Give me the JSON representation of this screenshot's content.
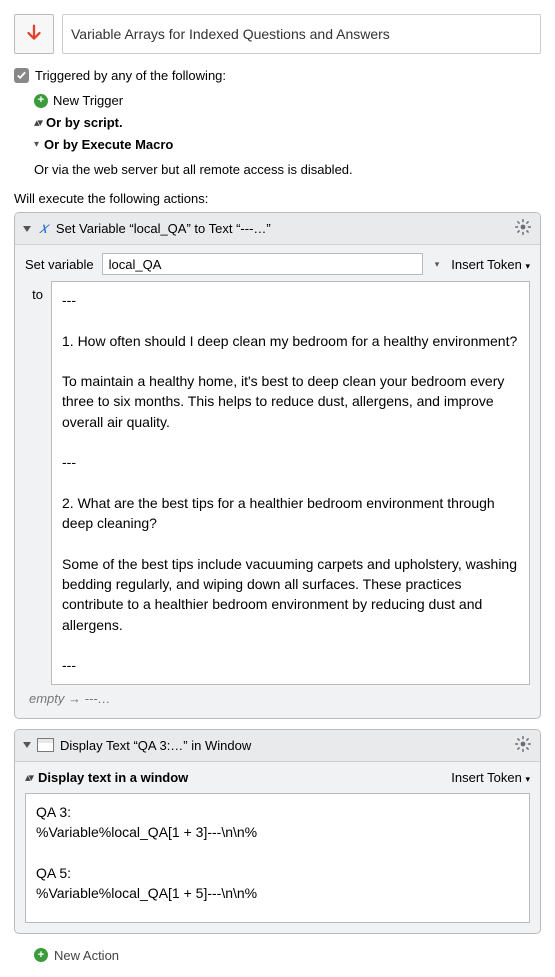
{
  "title": "Variable Arrays for Indexed Questions and Answers",
  "triggered_label": "Triggered by any of the following:",
  "triggers": {
    "new_trigger": "New Trigger",
    "or_script": "Or by script.",
    "or_execute_macro": "Or by Execute Macro",
    "web_note": "Or via the web server but all remote access is disabled."
  },
  "exec_label": "Will execute the following actions:",
  "action1": {
    "header": "Set Variable “local_QA” to Text “---…”",
    "set_variable_label": "Set variable",
    "variable_name": "local_QA",
    "insert_token": "Insert Token",
    "to_label": "to",
    "text_value": "---\n\n1. How often should I deep clean my bedroom for a healthy environment?\n\nTo maintain a healthy home, it's best to deep clean your bedroom every three to six months. This helps to reduce dust, allergens, and improve overall air quality.\n\n---\n\n2. What are the best tips for a healthier bedroom environment through deep cleaning?\n\nSome of the best tips include vacuuming carpets and upholstery, washing bedding regularly, and wiping down all surfaces. These practices contribute to a healthier bedroom environment by reducing dust and allergens.\n\n---",
    "empty_preview": "empty → ---…"
  },
  "action2": {
    "header": "Display Text “QA 3:…” in Window",
    "display_mode": "Display text in a window",
    "insert_token": "Insert Token",
    "text_value": "QA 3:\n%Variable%local_QA[1 + 3]---\\n\\n%\n\nQA 5:\n%Variable%local_QA[1 + 5]---\\n\\n%"
  },
  "new_action": "New Action",
  "chart_data": null
}
